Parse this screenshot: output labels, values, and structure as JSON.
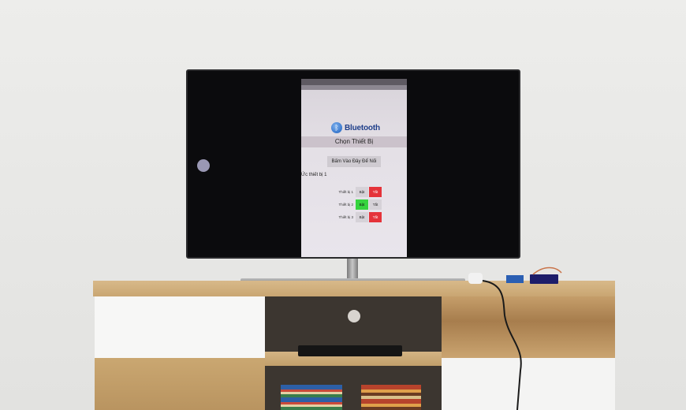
{
  "scene": {
    "colors": {
      "accent_red": "#e5333a",
      "accent_green": "#36d43f",
      "bluetooth_blue": "#1f3f8a"
    }
  },
  "phone_app": {
    "bluetooth_label": "Bluetooth",
    "choose_device": "Chọn Thiết Bị",
    "connect_button": "Bấm Vào Đây Để Nối",
    "device_label": "Ức thiết bị 1",
    "rows": [
      {
        "name": "Thiết bị 1",
        "on": "Bật",
        "off": "Tắt"
      },
      {
        "name": "Thiết bị 2",
        "on": "Bật",
        "off": "Tắt"
      },
      {
        "name": "Thiết bị 3",
        "on": "Bật",
        "off": "Tắt"
      }
    ]
  }
}
